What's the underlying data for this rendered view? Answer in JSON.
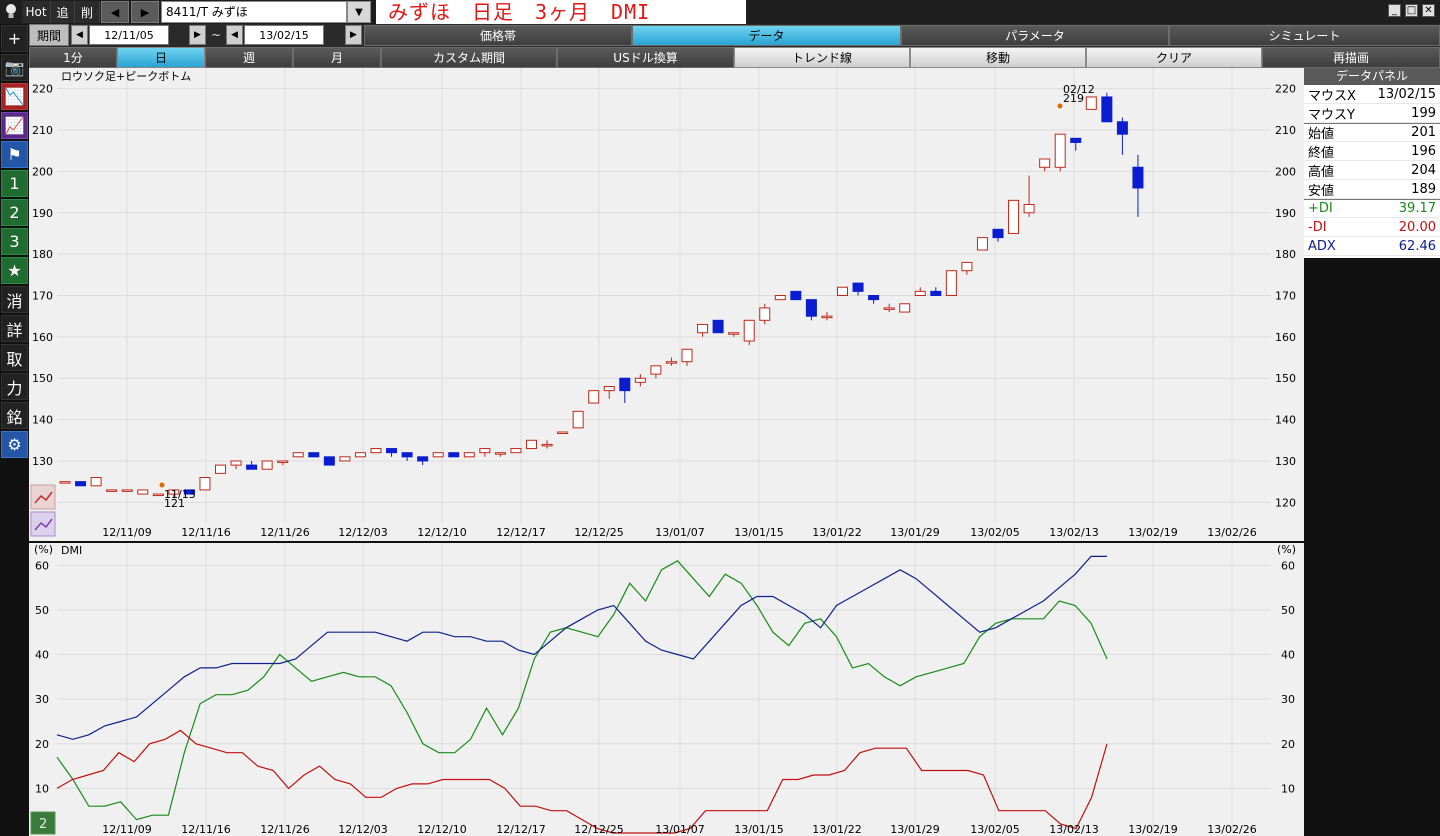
{
  "toolbar": {
    "hot_label": "Hot",
    "add_label": "追",
    "delete_label": "削",
    "prev_label": "◀",
    "next_label": "▶",
    "symbol": "8411/T みずほ",
    "title": "みずほ　日足　3ヶ月　DMI",
    "window_buttons": [
      "_",
      "□",
      "✕"
    ]
  },
  "period": {
    "label": "期間",
    "start": "12/11/05",
    "end": "13/02/15",
    "separator": "~"
  },
  "main_tabs": [
    {
      "label": "価格帯",
      "active": false
    },
    {
      "label": "データ",
      "active": true
    },
    {
      "label": "パラメータ",
      "active": false
    },
    {
      "label": "シミュレート",
      "active": false
    }
  ],
  "interval_buttons": [
    {
      "label": "1分",
      "active": false
    },
    {
      "label": "日",
      "active": true
    },
    {
      "label": "週",
      "active": false
    },
    {
      "label": "月",
      "active": false
    },
    {
      "label": "カスタム期間",
      "active": false
    },
    {
      "label": "USドル換算",
      "active": false
    }
  ],
  "action_buttons": [
    {
      "label": "トレンド線"
    },
    {
      "label": "移動"
    },
    {
      "label": "クリア"
    },
    {
      "label": "再描画"
    }
  ],
  "left_toolbar": [
    {
      "name": "crosshair-icon",
      "glyph": "+"
    },
    {
      "name": "camera-icon",
      "glyph": "📷"
    },
    {
      "name": "chart-red-icon",
      "glyph": "📉"
    },
    {
      "name": "chart-purple-icon",
      "glyph": "📈"
    },
    {
      "name": "flag-icon",
      "glyph": "⚑"
    },
    {
      "name": "preset-1",
      "glyph": "1"
    },
    {
      "name": "preset-2",
      "glyph": "2"
    },
    {
      "name": "preset-3",
      "glyph": "3"
    },
    {
      "name": "star-icon",
      "glyph": "★"
    },
    {
      "name": "erase-button",
      "glyph": "消"
    },
    {
      "name": "detail-button",
      "glyph": "詳"
    },
    {
      "name": "trade-button",
      "glyph": "取"
    },
    {
      "name": "power-button",
      "glyph": "力"
    },
    {
      "name": "issue-button",
      "glyph": "銘"
    },
    {
      "name": "settings-icon",
      "glyph": "⚙"
    }
  ],
  "data_panel": {
    "title": "データパネル",
    "rows_a": [
      {
        "label": "マウスX",
        "value": "13/02/15"
      },
      {
        "label": "マウスY",
        "value": "199"
      }
    ],
    "rows_b": [
      {
        "label": "始値",
        "value": "201"
      },
      {
        "label": "終値",
        "value": "196"
      },
      {
        "label": "高値",
        "value": "204"
      },
      {
        "label": "安値",
        "value": "189"
      }
    ],
    "rows_c": [
      {
        "label": "+DI",
        "value": "39.17",
        "color": "#1a8a1a"
      },
      {
        "label": "-DI",
        "value": "20.00",
        "color": "#c01010"
      },
      {
        "label": "ADX",
        "value": "62.46",
        "color": "#10208a"
      }
    ]
  },
  "price_panel": {
    "name": "ロウソク足+ピークボトム",
    "bottom_marker": {
      "date": "11/13",
      "value": "121"
    },
    "top_marker": {
      "date": "02/12",
      "value": "219"
    }
  },
  "dmi_panel": {
    "name": "DMI",
    "unit": "(%)",
    "bottom_badge": "2"
  },
  "chart_data": [
    {
      "type": "candlestick",
      "title": "ロウソク足+ピークボトム",
      "ylim": [
        115,
        225
      ],
      "yticks": [
        120,
        130,
        140,
        150,
        160,
        170,
        180,
        190,
        200,
        210,
        220
      ],
      "xticks": [
        "12/11/09",
        "12/11/16",
        "12/11/26",
        "12/12/03",
        "12/12/10",
        "12/12/17",
        "12/12/25",
        "13/01/07",
        "13/01/15",
        "13/01/22",
        "13/01/29",
        "13/02/05",
        "13/02/13",
        "13/02/19",
        "13/02/26"
      ],
      "colors": {
        "up": "#c0281c",
        "down": "#0a1ed0"
      },
      "candles": [
        [
          125,
          125,
          125,
          125
        ],
        [
          125,
          124,
          125,
          124
        ],
        [
          124,
          126,
          124,
          126
        ],
        [
          123,
          123,
          123,
          123
        ],
        [
          123,
          123,
          123,
          123
        ],
        [
          122,
          123,
          122,
          123
        ],
        [
          122,
          122,
          122,
          122
        ],
        [
          122,
          123,
          121,
          123
        ],
        [
          123,
          122,
          123,
          122
        ],
        [
          123,
          126,
          123,
          126
        ],
        [
          127,
          129,
          127,
          129
        ],
        [
          129,
          130,
          128,
          129
        ],
        [
          129,
          128,
          128,
          130
        ],
        [
          128,
          130,
          128,
          130
        ],
        [
          130,
          130,
          129,
          130
        ],
        [
          131,
          132,
          131,
          132
        ],
        [
          132,
          131,
          131,
          132
        ],
        [
          131,
          129,
          129,
          131
        ],
        [
          130,
          131,
          130,
          131
        ],
        [
          131,
          132,
          131,
          132
        ],
        [
          132,
          133,
          132,
          133
        ],
        [
          133,
          132,
          131,
          133
        ],
        [
          132,
          131,
          130,
          132
        ],
        [
          131,
          130,
          129,
          131
        ],
        [
          131,
          132,
          131,
          132
        ],
        [
          132,
          131,
          131,
          132
        ],
        [
          131,
          132,
          131,
          132
        ],
        [
          132,
          133,
          131,
          133
        ],
        [
          132,
          132,
          131,
          132
        ],
        [
          132,
          133,
          132,
          133
        ],
        [
          133,
          135,
          133,
          135
        ],
        [
          134,
          134,
          133,
          135
        ],
        [
          137,
          137,
          137,
          137
        ],
        [
          138,
          142,
          138,
          142
        ],
        [
          144,
          147,
          144,
          147
        ],
        [
          147,
          148,
          145,
          148
        ],
        [
          150,
          147,
          144,
          150
        ],
        [
          149,
          150,
          148,
          151
        ],
        [
          151,
          153,
          150,
          153
        ],
        [
          154,
          154,
          153,
          155
        ],
        [
          154,
          157,
          153,
          157
        ],
        [
          161,
          163,
          160,
          163
        ],
        [
          164,
          161,
          161,
          164
        ],
        [
          161,
          161,
          160,
          161
        ],
        [
          159,
          164,
          158,
          164
        ],
        [
          164,
          167,
          163,
          168
        ],
        [
          169,
          170,
          169,
          170
        ],
        [
          171,
          169,
          169,
          171
        ],
        [
          169,
          165,
          164,
          169
        ],
        [
          165,
          165,
          164,
          166
        ],
        [
          170,
          172,
          170,
          172
        ],
        [
          173,
          171,
          170,
          173
        ],
        [
          170,
          169,
          168,
          170
        ],
        [
          167,
          167,
          166,
          168
        ],
        [
          166,
          168,
          166,
          168
        ],
        [
          170,
          171,
          170,
          172
        ],
        [
          171,
          170,
          170,
          172
        ],
        [
          170,
          176,
          170,
          176
        ],
        [
          176,
          178,
          175,
          178
        ],
        [
          181,
          184,
          181,
          184
        ],
        [
          186,
          184,
          183,
          186
        ],
        [
          185,
          193,
          185,
          193
        ],
        [
          190,
          192,
          189,
          199
        ],
        [
          201,
          203,
          200,
          203
        ],
        [
          201,
          209,
          200,
          209
        ],
        [
          208,
          207,
          205,
          208
        ],
        [
          215,
          218,
          215,
          218
        ],
        [
          218,
          212,
          212,
          219
        ],
        [
          212,
          209,
          204,
          213
        ],
        [
          201,
          196,
          189,
          204
        ]
      ]
    },
    {
      "type": "line",
      "title": "DMI",
      "ylabel": "(%)",
      "ylim": [
        0,
        65
      ],
      "yticks": [
        10,
        20,
        30,
        40,
        50,
        60
      ],
      "series": [
        {
          "name": "+DI",
          "color": "#1a8a1a",
          "values": [
            17,
            12,
            6,
            6,
            7,
            3,
            4,
            4,
            18,
            29,
            31,
            31,
            32,
            35,
            40,
            37,
            34,
            35,
            36,
            35,
            35,
            33,
            27,
            20,
            18,
            18,
            21,
            28,
            22,
            28,
            39,
            45,
            46,
            45,
            44,
            49,
            56,
            52,
            59,
            61,
            57,
            53,
            58,
            56,
            51,
            45,
            42,
            47,
            48,
            44,
            37,
            38,
            35,
            33,
            35,
            36,
            37,
            38,
            44,
            47,
            48,
            48,
            48,
            52,
            51,
            47,
            39
          ],
          "color_name": "green"
        },
        {
          "name": "-DI",
          "color": "#c01010",
          "values": [
            10,
            12,
            13,
            14,
            18,
            16,
            20,
            21,
            23,
            20,
            19,
            18,
            18,
            15,
            14,
            10,
            13,
            15,
            12,
            11,
            8,
            8,
            10,
            11,
            11,
            12,
            12,
            12,
            12,
            10,
            6,
            6,
            5,
            5,
            3,
            1,
            0,
            0,
            0,
            0,
            0,
            1,
            5,
            5,
            5,
            5,
            5,
            12,
            12,
            13,
            13,
            14,
            18,
            19,
            19,
            19,
            14,
            14,
            14,
            14,
            13,
            5,
            5,
            5,
            5,
            2,
            1,
            8,
            20
          ]
        },
        {
          "name": "ADX",
          "color": "#10208a",
          "values": [
            22,
            21,
            22,
            24,
            25,
            26,
            29,
            32,
            35,
            37,
            37,
            38,
            38,
            38,
            38,
            39,
            42,
            45,
            45,
            45,
            45,
            44,
            43,
            45,
            45,
            44,
            44,
            43,
            43,
            41,
            40,
            43,
            46,
            48,
            50,
            51,
            47,
            43,
            41,
            40,
            39,
            43,
            47,
            51,
            53,
            53,
            51,
            49,
            46,
            51,
            53,
            55,
            57,
            59,
            57,
            54,
            51,
            48,
            45,
            46,
            48,
            50,
            52,
            55,
            58,
            62,
            62
          ]
        }
      ]
    }
  ]
}
